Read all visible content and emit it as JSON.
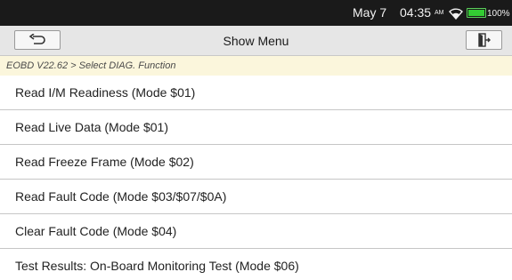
{
  "status_bar": {
    "date": "May 7",
    "time": "04:35",
    "ampm": "AM",
    "battery_text": "100%",
    "battery_level": 1.0,
    "battery_color": "#33cc33"
  },
  "toolbar": {
    "title": "Show Menu",
    "back_icon": "back-arrow-icon",
    "exit_icon": "exit-icon"
  },
  "breadcrumb": "EOBD V22.62 > Select DIAG. Function",
  "menu": {
    "items": [
      "Read I/M Readiness (Mode $01)",
      "Read Live Data (Mode $01)",
      "Read Freeze Frame (Mode $02)",
      "Read Fault Code (Mode $03/$07/$0A)",
      "Clear Fault Code (Mode $04)",
      "Test Results: On-Board Monitoring Test (Mode $06)"
    ]
  },
  "colors": {
    "status_bar_bg": "#1a1a1a",
    "toolbar_bg": "#e6e6e6",
    "breadcrumb_bg": "#fbf6dc",
    "divider": "#c6c6c6"
  }
}
